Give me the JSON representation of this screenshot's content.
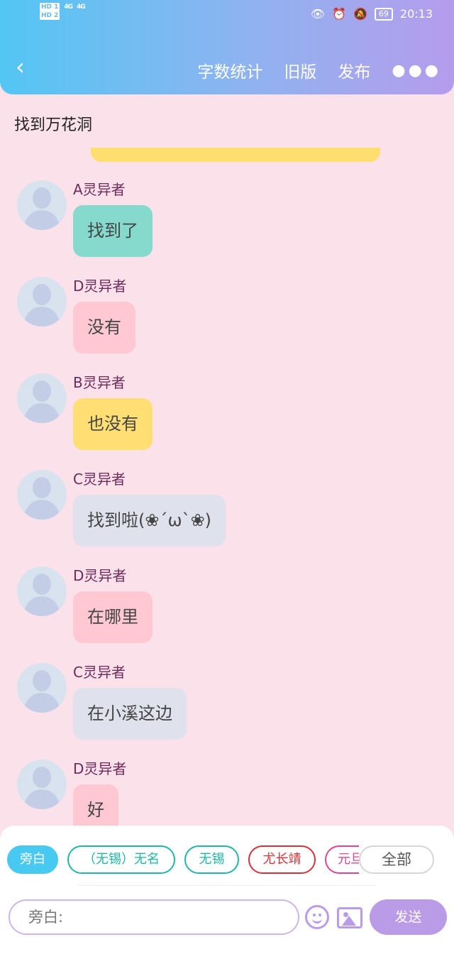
{
  "status_bar": {
    "hd1": "HD 1",
    "hd2": "HD 2",
    "signal1": "4G",
    "signal2": "4G",
    "battery": "69",
    "time": "20:13"
  },
  "header": {
    "back_icon": "chevron-left",
    "actions": [
      "字数统计",
      "旧版",
      "发布"
    ],
    "more": "●●●"
  },
  "chapter_title": "找到万花洞",
  "messages": [
    {
      "name": "A灵异者",
      "text": "找到了",
      "color": "#86d9cd"
    },
    {
      "name": "D灵异者",
      "text": "没有",
      "color": "#ffc8d3"
    },
    {
      "name": "B灵异者",
      "text": "也没有",
      "color": "#ffdf74"
    },
    {
      "name": "C灵异者",
      "text": "找到啦(❀´ω`❀)",
      "color": "#dfe2ec"
    },
    {
      "name": "D灵异者",
      "text": "在哪里",
      "color": "#ffc8d3"
    },
    {
      "name": "C灵异者",
      "text": "在小溪这边",
      "color": "#dfe2ec"
    },
    {
      "name": "D灵异者",
      "text": "好",
      "color": "#ffc8d3"
    }
  ],
  "chips": [
    {
      "label": "旁白",
      "style": "filled"
    },
    {
      "label": "（无锡）无名",
      "style": "teal"
    },
    {
      "label": "无锡",
      "style": "teal"
    },
    {
      "label": "尤长靖",
      "style": "red"
    },
    {
      "label": "元旦",
      "style": "pink"
    },
    {
      "label": "全部",
      "style": "gray"
    }
  ],
  "input": {
    "placeholder": "旁白:"
  },
  "send_label": "发送",
  "colors": {
    "accent": "#b99be8",
    "header_start": "#53c6f4",
    "header_end": "#b59cec",
    "background": "#fbe1ea"
  }
}
